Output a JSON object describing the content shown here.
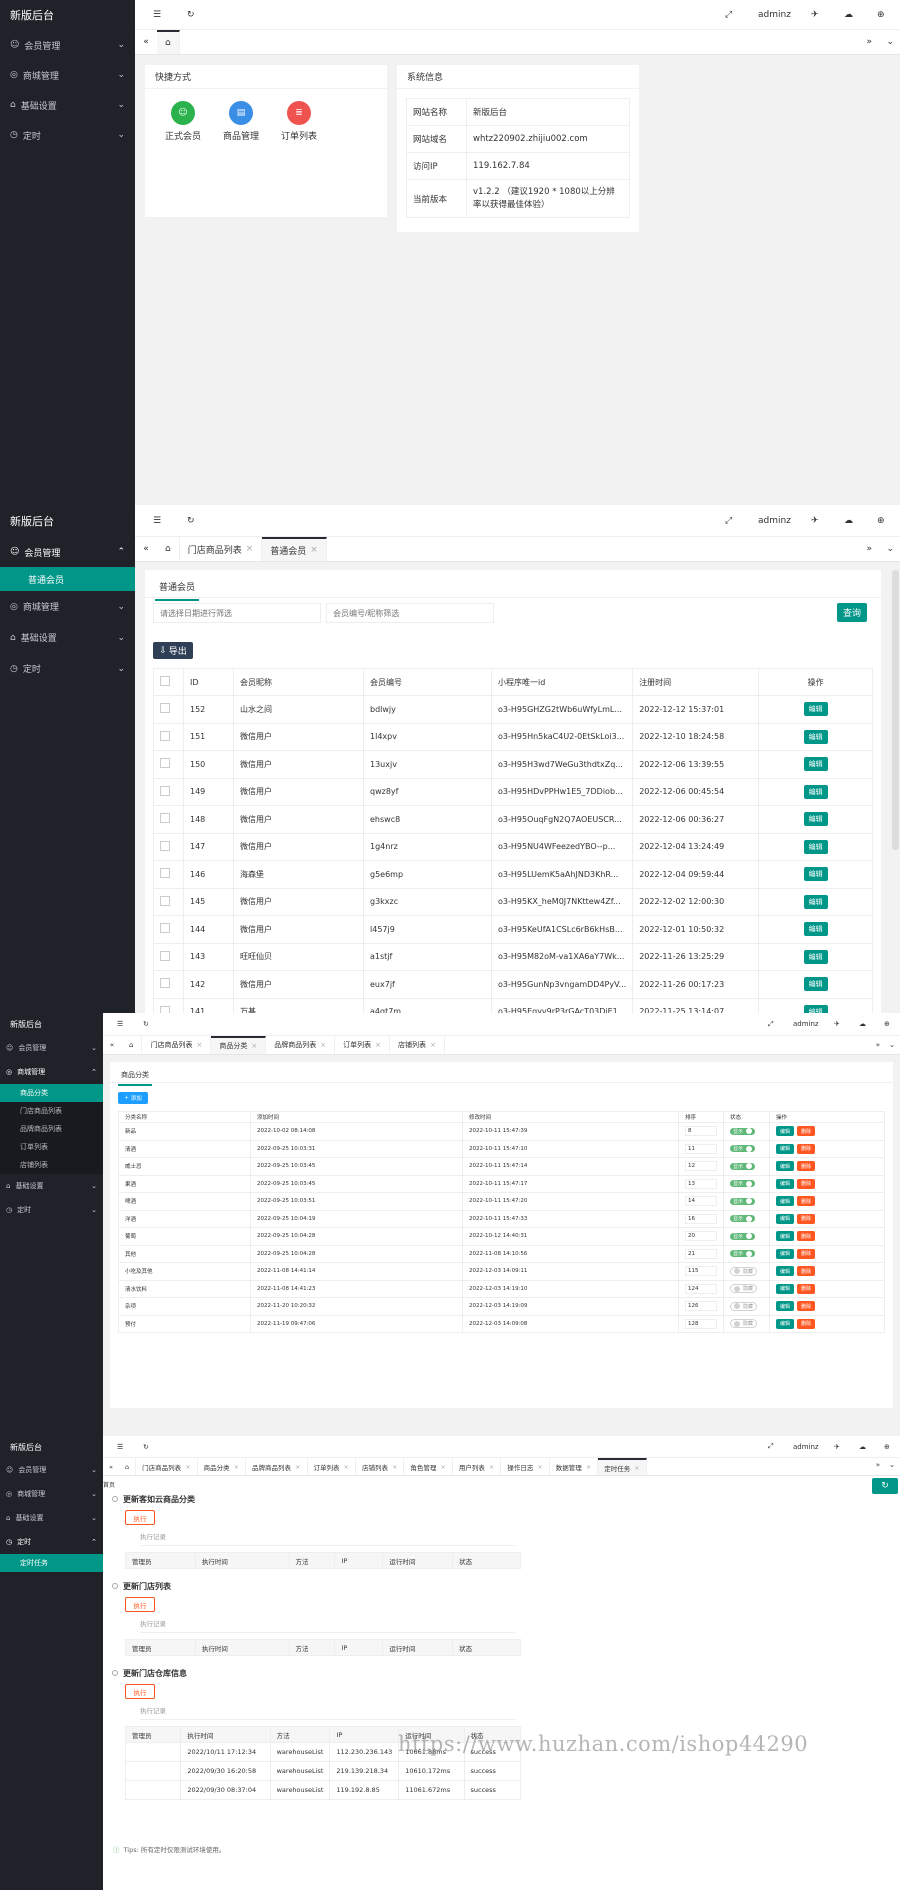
{
  "app_title": "新版后台",
  "user": "adminz",
  "menu": {
    "member": "会员管理",
    "shop": "商城管理",
    "base": "基础设置",
    "timer": "定时"
  },
  "s1": {
    "quick_title": "快捷方式",
    "quick": [
      "正式会员",
      "商品管理",
      "订单列表"
    ],
    "sys_title": "系统信息",
    "sys": [
      {
        "k": "网站名称",
        "v": "新版后台"
      },
      {
        "k": "网站域名",
        "v": "whtz220902.zhijiu002.com"
      },
      {
        "k": "访问IP",
        "v": "119.162.7.84"
      },
      {
        "k": "当前版本",
        "v": "v1.2.2 （建议1920 * 1080以上分辨率以获得最佳体验）"
      }
    ]
  },
  "s2": {
    "sub_item": "普通会员",
    "tabs": [
      "门店商品列表",
      "普通会员"
    ],
    "card_tab": "普通会员",
    "ph_date": "请选择日期进行筛选",
    "ph_no": "会员编号/昵称筛选",
    "search": "查询",
    "export": "导出",
    "cols": [
      "ID",
      "会员昵称",
      "会员编号",
      "小程序唯一id",
      "注册时间",
      "操作"
    ],
    "edit": "编辑",
    "rows": [
      [
        "152",
        "山水之间",
        "bdlwjy",
        "o3-H95GHZG2tWb6uWfyLmL...",
        "2022-12-12 15:37:01"
      ],
      [
        "151",
        "微信用户",
        "1l4xpv",
        "o3-H95Hn5kaC4U2-0EtSkLoi3...",
        "2022-12-10 18:24:58"
      ],
      [
        "150",
        "微信用户",
        "13uxjv",
        "o3-H95H3wd7WeGu3thdtxZq...",
        "2022-12-06 13:39:55"
      ],
      [
        "149",
        "微信用户",
        "qwz8yf",
        "o3-H95HDvPPHw1E5_7DDiob...",
        "2022-12-06 00:45:54"
      ],
      [
        "148",
        "微信用户",
        "ehswc8",
        "o3-H95OuqFgN2Q7AOEUSCR...",
        "2022-12-06 00:36:27"
      ],
      [
        "147",
        "微信用户",
        "1g4nrz",
        "o3-H95NU4WFeezedYBO--p...",
        "2022-12-04 13:24:49"
      ],
      [
        "146",
        "海森堡",
        "g5e6mp",
        "o3-H95LUemK5aAhJND3KhR...",
        "2022-12-04 09:59:44"
      ],
      [
        "145",
        "微信用户",
        "g3kxzc",
        "o3-H95KX_heM0J7NKttew4Zf...",
        "2022-12-02 12:00:30"
      ],
      [
        "144",
        "微信用户",
        "l457j9",
        "o3-H95KeUfA1CSLc6rB6kHsB...",
        "2022-12-01 10:50:32"
      ],
      [
        "143",
        "旺旺仙贝",
        "a1stjf",
        "o3-H95M82oM-va1XA6aY7Wk...",
        "2022-11-26 13:25:29"
      ],
      [
        "142",
        "微信用户",
        "eux7jf",
        "o3-H95GunNp3vngamDD4PyV...",
        "2022-11-26 00:17:23"
      ],
      [
        "141",
        "万基",
        "a4qt7m",
        "o3-H95Eqyv9rP3rGAcT03DjE1...",
        "2022-11-25 13:14:07"
      ]
    ]
  },
  "s3": {
    "subs": [
      "商品分类",
      "门店商品列表",
      "品牌商品列表",
      "订单列表",
      "店铺列表"
    ],
    "tabs": [
      "门店商品列表",
      "商品分类",
      "品牌商品列表",
      "订单列表",
      "店铺列表"
    ],
    "card_tab": "商品分类",
    "add": "添加",
    "cols": [
      "分类名称",
      "添加时间",
      "修改时间",
      "排序",
      "状态",
      "操作"
    ],
    "on": "显示",
    "off": "隐藏",
    "edit": "编辑",
    "del": "删除",
    "rows": [
      [
        "新品",
        "2022-10-02 08:14:08",
        "2022-10-11 15:47:39",
        "8",
        1
      ],
      [
        "清酒",
        "2022-09-25 10:03:31",
        "2022-10-11 15:47:10",
        "11",
        1
      ],
      [
        "威士忌",
        "2022-09-25 10:03:45",
        "2022-10-11 15:47:14",
        "12",
        1
      ],
      [
        "果酒",
        "2022-09-25 10:03:45",
        "2022-10-11 15:47:17",
        "13",
        1
      ],
      [
        "啤酒",
        "2022-09-25 10:03:51",
        "2022-10-11 15:47:20",
        "14",
        1
      ],
      [
        "洋酒",
        "2022-09-25 10:04:19",
        "2022-10-11 15:47:33",
        "16",
        1
      ],
      [
        "葡萄",
        "2022-09-25 10:04:28",
        "2022-10-12 14:40:31",
        "20",
        1
      ],
      [
        "其他",
        "2022-09-25 10:04:28",
        "2022-11-08 14:10:56",
        "21",
        1
      ],
      [
        "小吃及其他",
        "2022-11-08 14:41:14",
        "2022-12-03 14:09:11",
        "115",
        0
      ],
      [
        "清水饮料",
        "2022-11-08 14:41:23",
        "2022-12-03 14:19:10",
        "124",
        0
      ],
      [
        "杂项",
        "2022-11-20 10:20:32",
        "2022-12-03 14:19:09",
        "126",
        0
      ],
      [
        "预付",
        "2022-11-19 09:47:06",
        "2022-12-03 14:09:08",
        "128",
        0
      ]
    ]
  },
  "s4": {
    "sub_item": "定时任务",
    "tabs": [
      "门店商品列表",
      "商品分类",
      "品牌商品列表",
      "订单列表",
      "店铺列表",
      "角色管理",
      "用户列表",
      "操作日志",
      "数据管理",
      "定时任务"
    ],
    "side_mark": "首页",
    "run": "执行",
    "log": "执行记录",
    "cols": [
      "管理员",
      "执行时间",
      "方法",
      "IP",
      "运行时间",
      "状态"
    ],
    "tasks": [
      {
        "title": "更新客如云商品分类",
        "rows": []
      },
      {
        "title": "更新门店列表",
        "rows": []
      },
      {
        "title": "更新门店仓库信息",
        "rows": [
          [
            "",
            "2022/10/11 17:12:34",
            "warehouseList",
            "112.230.236.143",
            "10661.88ms",
            "success"
          ],
          [
            "",
            "2022/09/30 16:20:58",
            "warehouseList",
            "219.139.218.34",
            "10610.172ms",
            "success"
          ],
          [
            "",
            "2022/09/30 08:37:04",
            "warehouseList",
            "119.192.8.85",
            "11061.672ms",
            "success"
          ]
        ]
      }
    ],
    "tips": "Tips: 所有定时仅限测试环境使用。",
    "watermark": "https://www.huzhan.com/ishop44290"
  }
}
